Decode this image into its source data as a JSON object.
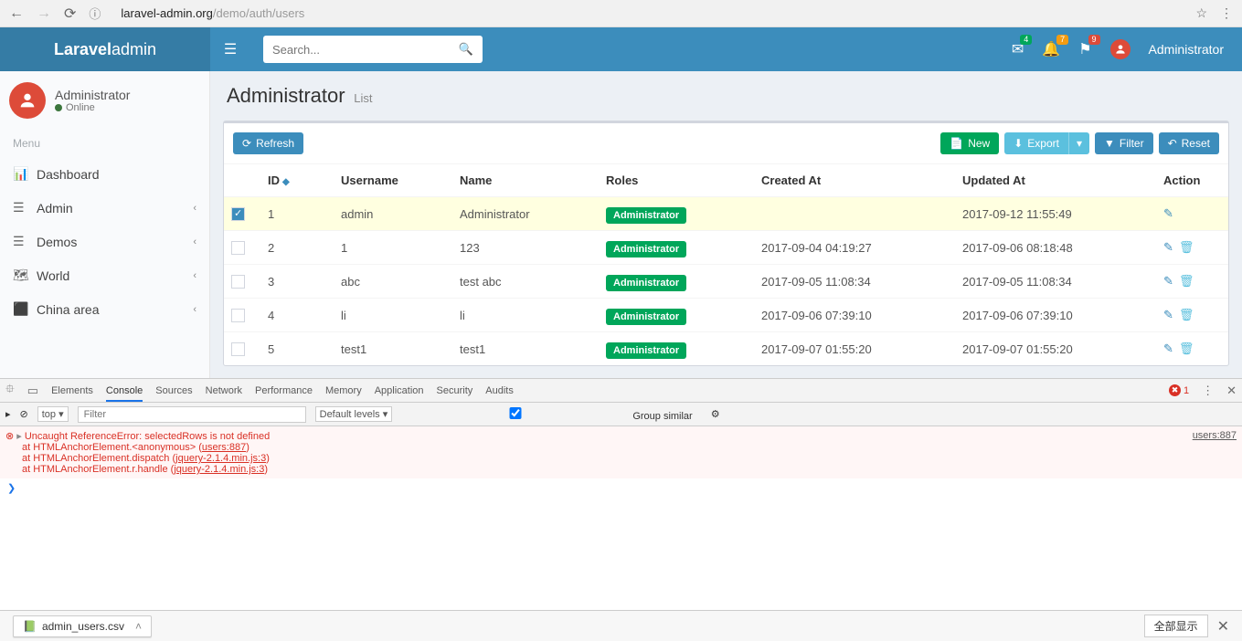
{
  "browser": {
    "url_host": "laravel-admin.org",
    "url_path": "/demo/auth/users"
  },
  "brand": {
    "bold": "Laravel",
    "light": " admin"
  },
  "search": {
    "placeholder": "Search..."
  },
  "header": {
    "badges": {
      "mail": "4",
      "bell": "7",
      "flag": "9"
    },
    "user": "Administrator"
  },
  "sidebar": {
    "user": "Administrator",
    "status": "Online",
    "menu_label": "Menu",
    "items": [
      {
        "icon": "bar",
        "label": "Dashboard",
        "arrow": false
      },
      {
        "icon": "list",
        "label": "Admin",
        "arrow": true
      },
      {
        "icon": "list",
        "label": "Demos",
        "arrow": true
      },
      {
        "icon": "map",
        "label": "World",
        "arrow": true
      },
      {
        "icon": "map2",
        "label": "China area",
        "arrow": true
      }
    ]
  },
  "page": {
    "title": "Administrator",
    "sub": "List"
  },
  "toolbar": {
    "refresh": "Refresh",
    "new": "New",
    "export": "Export",
    "filter": "Filter",
    "reset": "Reset"
  },
  "table": {
    "headers": {
      "id": "ID",
      "username": "Username",
      "name": "Name",
      "roles": "Roles",
      "created": "Created At",
      "updated": "Updated At",
      "action": "Action"
    },
    "rows": [
      {
        "sel": true,
        "id": "1",
        "username": "admin",
        "name": "Administrator",
        "role": "Administrator",
        "created": "",
        "updated": "2017-09-12 11:55:49",
        "del": false
      },
      {
        "sel": false,
        "id": "2",
        "username": "1",
        "name": "123",
        "role": "Administrator",
        "created": "2017-09-04 04:19:27",
        "updated": "2017-09-06 08:18:48",
        "del": true
      },
      {
        "sel": false,
        "id": "3",
        "username": "abc",
        "name": "test abc",
        "role": "Administrator",
        "created": "2017-09-05 11:08:34",
        "updated": "2017-09-05 11:08:34",
        "del": true
      },
      {
        "sel": false,
        "id": "4",
        "username": "li",
        "name": "li",
        "role": "Administrator",
        "created": "2017-09-06 07:39:10",
        "updated": "2017-09-06 07:39:10",
        "del": true
      },
      {
        "sel": false,
        "id": "5",
        "username": "test1",
        "name": "test1",
        "role": "Administrator",
        "created": "2017-09-07 01:55:20",
        "updated": "2017-09-07 01:55:20",
        "del": true
      }
    ]
  },
  "devtools": {
    "tabs": [
      "Elements",
      "Console",
      "Sources",
      "Network",
      "Performance",
      "Memory",
      "Application",
      "Security",
      "Audits"
    ],
    "active_tab": "Console",
    "scope": "top",
    "filter_placeholder": "Filter",
    "levels": "Default levels",
    "group": "Group similar",
    "error_count": "1",
    "error_src": "users:887",
    "lines": [
      "Uncaught ReferenceError: selectedRows is not defined",
      "at HTMLAnchorElement.<anonymous> (users:887)",
      "at HTMLAnchorElement.dispatch (jquery-2.1.4.min.js:3)",
      "at HTMLAnchorElement.r.handle (jquery-2.1.4.min.js:3)"
    ],
    "stack_links": [
      "users:887",
      "jquery-2.1.4.min.js:3",
      "jquery-2.1.4.min.js:3"
    ]
  },
  "download": {
    "file": "admin_users.csv",
    "showall": "全部显示"
  }
}
